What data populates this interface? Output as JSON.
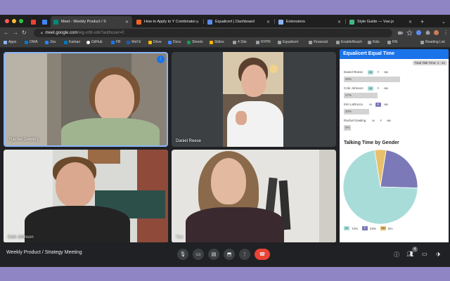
{
  "colors": {
    "desktop": "#8f84c4",
    "male": "#a8dcd8",
    "female": "#7b79b7",
    "nonbinary": "#e9c16c",
    "end_call": "#ea4335",
    "active_speaker": "#8ab4f8"
  },
  "tabs": [
    {
      "icon": "gmail-icon",
      "label": ""
    },
    {
      "icon": "calendar-icon",
      "label": ""
    },
    {
      "icon": "meet-icon",
      "label": "Meet - Weekly Product / S",
      "active": true
    },
    {
      "icon": "ycombinator-icon",
      "label": "How to Apply to Y Combinator"
    },
    {
      "icon": "equalicert-icon",
      "label": "Equalicert | Dashboard"
    },
    {
      "icon": "puzzle-icon",
      "label": "Extensions"
    },
    {
      "icon": "vue-icon",
      "label": "Style Guide — Vue.js"
    }
  ],
  "omnibox": {
    "host": "meet.google.com",
    "path": "/wg-xrbt-xdx?authuser=0"
  },
  "bookmarks": [
    {
      "label": "Apps",
      "icon": "apps-icon"
    },
    {
      "label": "OWA",
      "icon": "outlook-icon"
    },
    {
      "label": "Jira",
      "icon": "jira-icon"
    },
    {
      "label": "Karban",
      "icon": "trello-icon"
    },
    {
      "label": "GitHub",
      "icon": "github-icon"
    },
    {
      "label": "FB",
      "icon": "facebook-icon"
    },
    {
      "label": "Wef E",
      "icon": "wef-icon"
    },
    {
      "label": "Drive",
      "icon": "drive-icon"
    },
    {
      "label": "Docs",
      "icon": "docs-icon"
    },
    {
      "label": "Sheets",
      "icon": "sheets-icon"
    },
    {
      "label": "Slides",
      "icon": "slides-icon"
    },
    {
      "label": "4 Site",
      "icon": "folder-icon"
    },
    {
      "label": "NYPR",
      "icon": "folder-icon"
    },
    {
      "label": "Equalicert",
      "icon": "folder-icon"
    },
    {
      "label": "Financial",
      "icon": "folder-icon"
    },
    {
      "label": "EnableReach",
      "icon": "folder-icon"
    },
    {
      "label": "Kids",
      "icon": "folder-icon"
    },
    {
      "label": "RN",
      "icon": "folder-icon"
    }
  ],
  "bookmarks_right": "Reading List",
  "participants": [
    {
      "name": "Rachel Dowling",
      "speaking": true
    },
    {
      "name": "Daniel Reese"
    },
    {
      "name": "Cole Johnson"
    },
    {
      "name": "You"
    }
  ],
  "meeting": {
    "title": "Weekly Product / Strategy Meeting",
    "people_count": "4"
  },
  "extension": {
    "title": "Equalicert Equal Time",
    "total": "Total Talk Time: 1 : 41",
    "gender_buttons": [
      "M",
      "F",
      "NB"
    ],
    "people": [
      {
        "name": "Daniel Reese",
        "pct_label": "45%",
        "pct": 45,
        "selected": "M"
      },
      {
        "name": "Cole Johnson",
        "pct_label": "27%",
        "pct": 27,
        "selected": "M"
      },
      {
        "name": "Kim LaRocca",
        "pct_label": "20%",
        "pct": 20,
        "selected": "F"
      },
      {
        "name": "Rachel Dowling",
        "pct_label": "5%",
        "pct": 5,
        "selected": null
      }
    ],
    "chart_title": "Talking Time by Gender",
    "legend": [
      {
        "key": "M",
        "pct": "72%"
      },
      {
        "key": "F",
        "pct": "23%"
      },
      {
        "key": "NB",
        "pct": "5%"
      }
    ]
  },
  "chart_data": {
    "type": "pie",
    "title": "Talking Time by Gender",
    "categories": [
      "M",
      "F",
      "NB"
    ],
    "values": [
      72,
      23,
      5
    ],
    "colors": [
      "#a8dcd8",
      "#7b79b7",
      "#e9c16c"
    ]
  }
}
